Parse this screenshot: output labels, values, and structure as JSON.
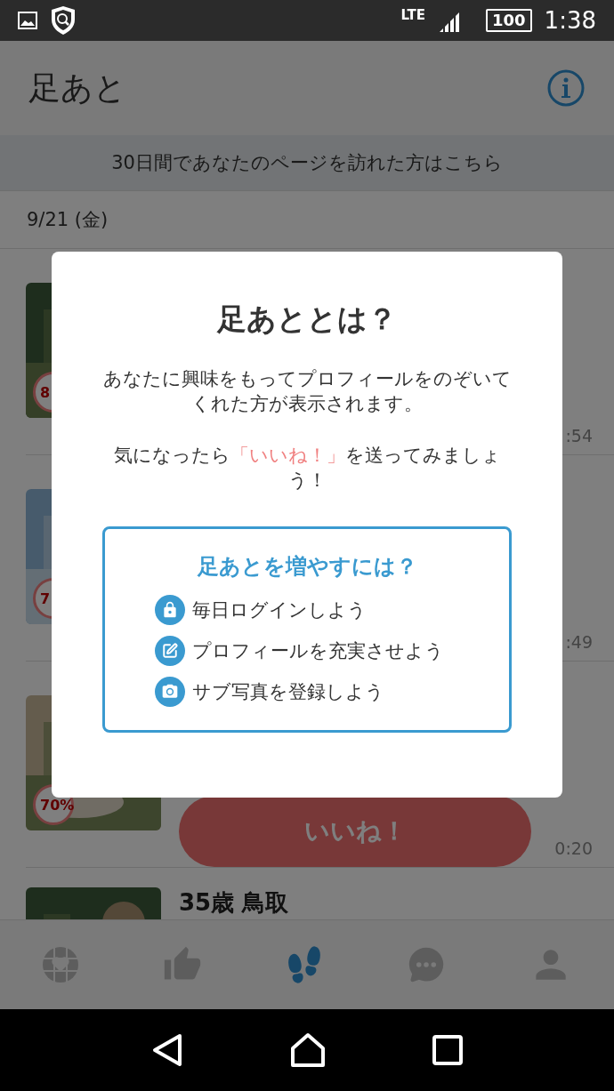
{
  "status_bar": {
    "network": "LTE",
    "battery": "100",
    "time": "1:38"
  },
  "header": {
    "title": "足あと"
  },
  "banner": "30日間であなたのページを訪れた方はこちら",
  "date": "9/21 (金)",
  "visitors": [
    {
      "match": "8",
      "time": ":54"
    },
    {
      "match": "7",
      "time": ":49"
    },
    {
      "match": "70%",
      "like_label": "いいね！",
      "time": "0:20"
    },
    {
      "name": "35歳 鳥取"
    }
  ],
  "tabs": [
    {
      "kind": "globe",
      "selected": false
    },
    {
      "kind": "like",
      "selected": false
    },
    {
      "kind": "footprints",
      "selected": true
    },
    {
      "kind": "chat",
      "selected": false
    },
    {
      "kind": "profile",
      "selected": false
    }
  ],
  "dialog": {
    "title": "足あととは？",
    "paragraphs": [
      [
        {
          "text": "あなたに興味をもってプロフィールをのぞいてくれた方が表示されます。",
          "highlight": false
        }
      ],
      [
        {
          "text": "気になったら",
          "highlight": false
        },
        {
          "text": "「いいね！」",
          "highlight": true
        },
        {
          "text": "を送ってみましょう！",
          "highlight": false
        }
      ]
    ],
    "tips": {
      "title": "足あとを増やすには？",
      "items": [
        {
          "kind": "lock",
          "text": "毎日ログインしよう"
        },
        {
          "kind": "edit",
          "text": "プロフィールを充実させよう"
        },
        {
          "kind": "camera",
          "text": "サブ写真を登録しよう"
        }
      ]
    }
  }
}
